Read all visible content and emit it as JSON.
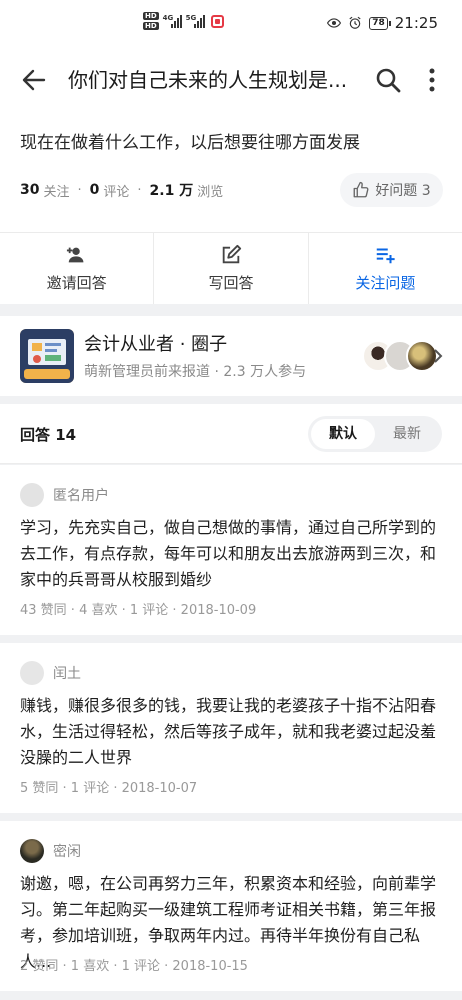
{
  "status_bar": {
    "left_badges": [
      "HD",
      "HD"
    ],
    "net_4g": "4G",
    "net_5g": "5G",
    "battery": "78",
    "time": "21:25",
    "icons": [
      "eye-icon",
      "alarm-icon",
      "recording-icon"
    ]
  },
  "header": {
    "title": "你们对自己未来的人生规划是...",
    "icons": [
      "back-arrow-icon",
      "search-icon",
      "more-vertical-icon"
    ]
  },
  "question": {
    "text": "现在在做着什么工作，以后想要往哪方面发展",
    "followers_count": "30",
    "followers_label": "关注",
    "comments_count": "0",
    "comments_label": "评论",
    "views_count": "2.1 万",
    "views_label": "浏览",
    "good_question_label": "好问题 3"
  },
  "actions": [
    {
      "label": "邀请回答",
      "icon": "invite-user-icon"
    },
    {
      "label": "写回答",
      "icon": "edit-icon"
    },
    {
      "label": "关注问题",
      "icon": "follow-list-icon",
      "active": true
    }
  ],
  "circle": {
    "name": "会计从业者 · 圈子",
    "subtitle": "萌新管理员前来报道 · 2.3 万人参与"
  },
  "answers_header": {
    "label": "回答 14",
    "sort_options": [
      "默认",
      "最新"
    ],
    "selected": "默认"
  },
  "answers": [
    {
      "user": "匿名用户",
      "body": "学习，先充实自己，做自己想做的事情，通过自己所学到的去工作，有点存款，每年可以和朋友出去旅游两到三次，和家中的兵哥哥从校服到婚纱",
      "meta": "43 赞同 · 4 喜欢 · 1 评论 · 2018-10-09"
    },
    {
      "user": "闰土",
      "body": "赚钱，赚很多很多的钱，我要让我的老婆孩子十指不沾阳春水，生活过得轻松，然后等孩子成年，就和我老婆过起没羞没臊的二人世界",
      "meta": "5 赞同 · 1 评论 · 2018-10-07"
    },
    {
      "user": "密闲",
      "body": "谢邀，嗯，在公司再努力三年，积累资本和经验，向前辈学习。第二年起购买一级建筑工程师考证相关书籍，第三年报考，参加培训班，争取两年内过。再待半年换份有自己私人...",
      "meta": "2 赞同 · 1 喜欢 · 1 评论 · 2018-10-15"
    }
  ],
  "colors": {
    "accent": "#0a66e4",
    "background": "#f0f1f3",
    "secondary_text": "#8a8a8a"
  }
}
